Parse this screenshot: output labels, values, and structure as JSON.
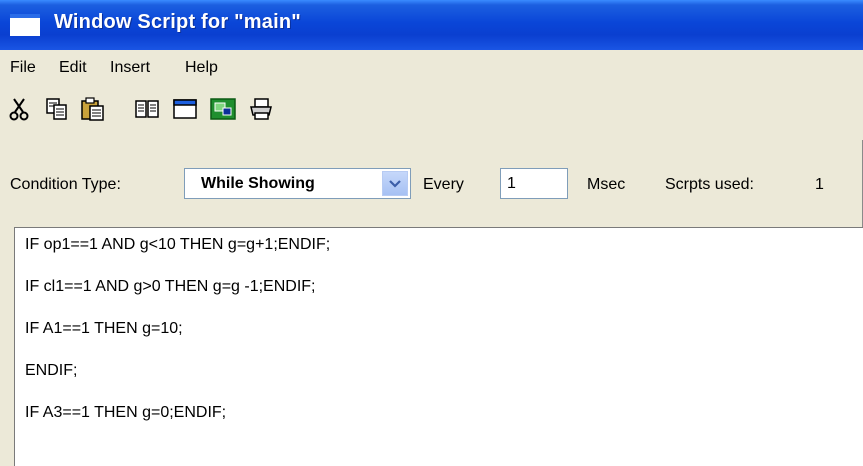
{
  "window": {
    "title": "Window Script for \"main\""
  },
  "menu": {
    "items": [
      "File",
      "Edit",
      "Insert",
      "Help"
    ]
  },
  "toolbar": {
    "buttons": [
      "cut-icon",
      "copy-icon",
      "paste-icon",
      "book-icon",
      "window-icon",
      "image-icon",
      "print-icon"
    ]
  },
  "condition": {
    "label": "Condition Type:",
    "type_value": "While Showing",
    "every_label": "Every",
    "every_value": "1",
    "msec_label": "Msec",
    "scripts_used_label": "Scrpts used:",
    "scripts_used_value": "1"
  },
  "editor": {
    "lines": [
      "IF op1==1 AND g<10 THEN g=g+1;ENDIF;",
      "IF cl1==1 AND g>0 THEN g=g -1;ENDIF;",
      "IF A1==1 THEN g=10;",
      "ENDIF;",
      "IF A3==1 THEN g=0;ENDIF;"
    ]
  },
  "colors": {
    "title_bar": "#0a46d8",
    "window_bg": "#ece9d8",
    "editor_bg": "#ffffff"
  }
}
